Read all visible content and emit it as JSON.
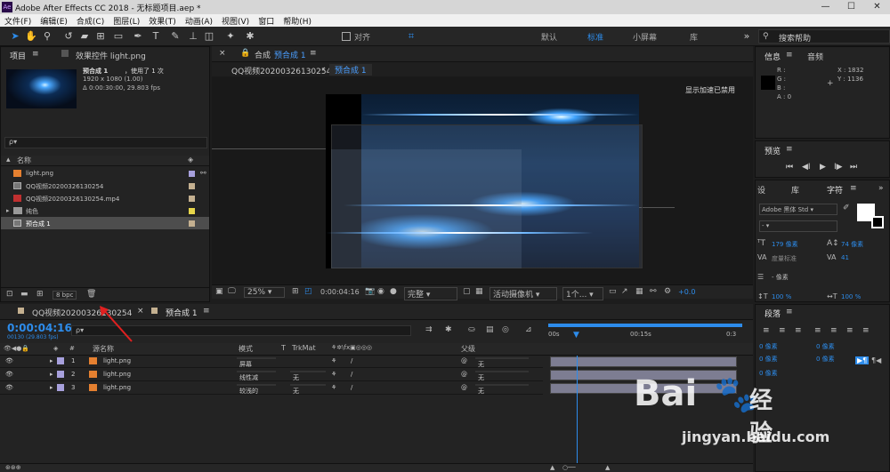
{
  "window": {
    "title": "Adobe After Effects CC 2018 - 无标题项目.aep *",
    "app_icon": "Ae",
    "minimize": "—",
    "maximize": "☐",
    "close": "✕"
  },
  "menu": [
    "文件(F)",
    "编辑(E)",
    "合成(C)",
    "图层(L)",
    "效果(T)",
    "动画(A)",
    "视图(V)",
    "窗口",
    "帮助(H)"
  ],
  "toolbar": {
    "align_label": "对齐",
    "workspaces": [
      "默认",
      "标准",
      "小屏幕",
      "库"
    ],
    "active_workspace": "标准",
    "search_placeholder": "搜索帮助"
  },
  "project_panel": {
    "tab_label": "项目",
    "effects_tab": "效果控件 light.png",
    "selected": {
      "name": "预合成 1",
      "usage": "，使用了 1 次",
      "size": "1920 x 1080 (1.00)",
      "duration": "Δ 0:00:30:00, 29.803 fps"
    },
    "search_icon": "ρ▾",
    "column_name": "名称",
    "items": [
      {
        "name": "light.png",
        "type": "image",
        "color": "#a7a0dc"
      },
      {
        "name": "QQ视频20200326130254",
        "type": "comp",
        "color": "#c4b090"
      },
      {
        "name": "QQ视频20200326130254.mp4",
        "type": "video",
        "color": "#c4b090"
      },
      {
        "name": "纯色",
        "type": "folder",
        "color": "#e6d54a"
      },
      {
        "name": "预合成 1",
        "type": "comp",
        "color": "#c4b090"
      }
    ],
    "bpc": "8 bpc"
  },
  "composition": {
    "tab_prefix": "合成",
    "tab_name": "预合成 1",
    "breadcrumb": [
      "QQ视频20200326130254",
      "预合成 1"
    ],
    "accel_msg": "显示加速已禁用",
    "zoom": "25%",
    "timecode": "0:00:04:16",
    "quality": "完整",
    "camera": "活动摄像机",
    "views": "1个...",
    "exposure": "+0.0"
  },
  "info_panel": {
    "tabs": [
      "信息",
      "音频"
    ],
    "r": "R :",
    "g": "G :",
    "b": "B :",
    "a": "A : 0",
    "x": "X : 1832",
    "y": "Y : 1136"
  },
  "preview_panel": {
    "tab": "预览"
  },
  "character_panel": {
    "tabs": [
      "设",
      "库",
      "字符"
    ],
    "font": "Adobe 黑体 Std",
    "style": "-",
    "size": "179 像素",
    "leading": "74 像素",
    "kerning": "度量标准",
    "tracking": "41",
    "stroke_width": "- 像素",
    "vscale": "100 %",
    "hscale": "100 %"
  },
  "paragraph_panel": {
    "tab": "段落",
    "indent_values": [
      "0 像素",
      "0 像素",
      "0 像素",
      "0 像素",
      "0 像素"
    ]
  },
  "timeline": {
    "tabs": [
      "QQ视频20200326130254",
      "预合成 1"
    ],
    "timecode": "0:00:04:16",
    "frame_info": "00130 (29.803 fps)",
    "columns": {
      "source": "源名称",
      "mode": "模式",
      "t": "T",
      "trkmat": "TrkMat",
      "parent": "父级"
    },
    "ruler": [
      "00s",
      "00:15s",
      "0:3"
    ],
    "layers": [
      {
        "num": "1",
        "name": "light.png",
        "mode": "屏幕",
        "trkmat": "",
        "parent": "无"
      },
      {
        "num": "2",
        "name": "light.png",
        "mode": "线性减",
        "trkmat": "无",
        "parent": "无"
      },
      {
        "num": "3",
        "name": "light.png",
        "mode": "较浅的",
        "trkmat": "无",
        "parent": "无"
      }
    ]
  },
  "watermark": {
    "brand": "Bai",
    "brand2": "经验",
    "url": "jingyan.baidu.com"
  }
}
